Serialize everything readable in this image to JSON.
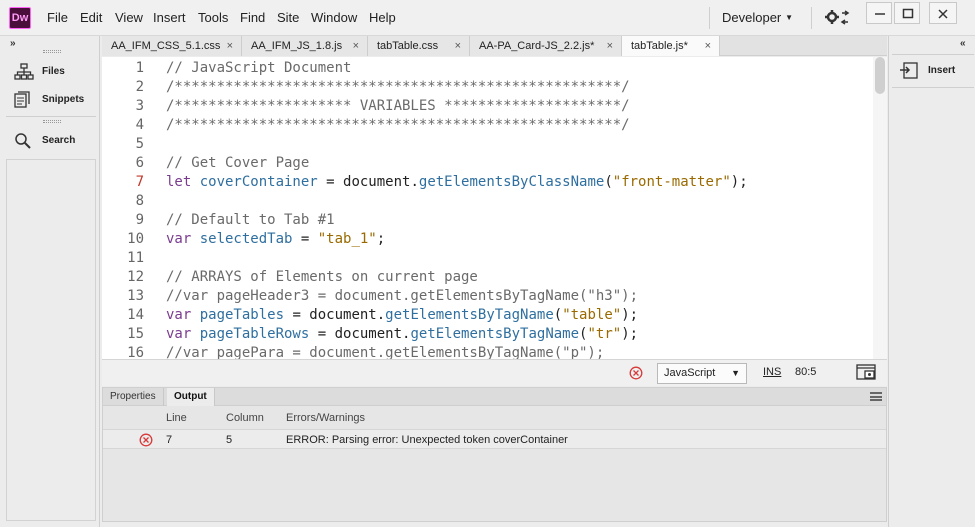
{
  "app": {
    "logo_text": "Dw"
  },
  "menu": [
    "File",
    "Edit",
    "View",
    "Insert",
    "Tools",
    "Find",
    "Site",
    "Window",
    "Help"
  ],
  "workspace": {
    "label": "Developer"
  },
  "left_panel": {
    "collapse_label": "»",
    "items": [
      {
        "label": "Files",
        "icon": "files-icon"
      },
      {
        "label": "Snippets",
        "icon": "snippets-icon"
      },
      {
        "label": "Search",
        "icon": "search-icon"
      }
    ]
  },
  "right_panel": {
    "collapse_label": "«",
    "insert_label": "Insert"
  },
  "tabs": [
    {
      "label": "AA_IFM_CSS_5.1.css",
      "active": false
    },
    {
      "label": "AA_IFM_JS_1.8.js",
      "active": false
    },
    {
      "label": "tabTable.css",
      "active": false
    },
    {
      "label": "AA-PA_Card-JS_2.2.js*",
      "active": false
    },
    {
      "label": "tabTable.js*",
      "active": true
    }
  ],
  "tab_close_label": "×",
  "code_lines": [
    {
      "n": "1",
      "tokens": [
        {
          "t": "// JavaScript Document",
          "c": "comment"
        }
      ]
    },
    {
      "n": "2",
      "tokens": [
        {
          "t": "/*****************************************************/",
          "c": "comment"
        }
      ]
    },
    {
      "n": "3",
      "tokens": [
        {
          "t": "/********************* VARIABLES *********************/",
          "c": "comment"
        }
      ]
    },
    {
      "n": "4",
      "tokens": [
        {
          "t": "/*****************************************************/",
          "c": "comment"
        }
      ]
    },
    {
      "n": "5",
      "tokens": []
    },
    {
      "n": "6",
      "tokens": [
        {
          "t": "// Get Cover Page",
          "c": "comment"
        }
      ]
    },
    {
      "n": "7",
      "error": true,
      "tokens": [
        {
          "t": "let ",
          "c": "keyword"
        },
        {
          "t": "coverContainer",
          "c": "variable"
        },
        {
          "t": " = document.",
          "c": "plain"
        },
        {
          "t": "getElementsByClassName",
          "c": "method"
        },
        {
          "t": "(",
          "c": "plain"
        },
        {
          "t": "\"front-matter\"",
          "c": "string"
        },
        {
          "t": ");",
          "c": "plain"
        }
      ]
    },
    {
      "n": "8",
      "tokens": []
    },
    {
      "n": "9",
      "tokens": [
        {
          "t": "// Default to Tab #1",
          "c": "comment"
        }
      ]
    },
    {
      "n": "10",
      "tokens": [
        {
          "t": "var ",
          "c": "keyword"
        },
        {
          "t": "selectedTab",
          "c": "variable"
        },
        {
          "t": " = ",
          "c": "plain"
        },
        {
          "t": "\"tab_1\"",
          "c": "string"
        },
        {
          "t": ";",
          "c": "plain"
        }
      ]
    },
    {
      "n": "11",
      "tokens": []
    },
    {
      "n": "12",
      "tokens": [
        {
          "t": "// ARRAYS of Elements on current page",
          "c": "comment"
        }
      ]
    },
    {
      "n": "13",
      "tokens": [
        {
          "t": "//var pageHeader3 = document.getElementsByTagName(\"h3\");",
          "c": "comment"
        }
      ]
    },
    {
      "n": "14",
      "tokens": [
        {
          "t": "var ",
          "c": "keyword"
        },
        {
          "t": "pageTables",
          "c": "variable"
        },
        {
          "t": " = document.",
          "c": "plain"
        },
        {
          "t": "getElementsByTagName",
          "c": "method"
        },
        {
          "t": "(",
          "c": "plain"
        },
        {
          "t": "\"table\"",
          "c": "string"
        },
        {
          "t": ");",
          "c": "plain"
        }
      ]
    },
    {
      "n": "15",
      "tokens": [
        {
          "t": "var ",
          "c": "keyword"
        },
        {
          "t": "pageTableRows",
          "c": "variable"
        },
        {
          "t": " = document.",
          "c": "plain"
        },
        {
          "t": "getElementsByTagName",
          "c": "method"
        },
        {
          "t": "(",
          "c": "plain"
        },
        {
          "t": "\"tr\"",
          "c": "string"
        },
        {
          "t": ");",
          "c": "plain"
        }
      ]
    },
    {
      "n": "16",
      "tokens": [
        {
          "t": "//var pagePara = document.getElementsByTagName(\"p\");",
          "c": "comment"
        }
      ]
    }
  ],
  "status_bar": {
    "language": "JavaScript",
    "mode": "INS",
    "position": "80:5"
  },
  "bottom_panel": {
    "tabs": [
      {
        "label": "Properties",
        "active": false
      },
      {
        "label": "Output",
        "active": true
      }
    ],
    "columns": {
      "line": "Line",
      "column": "Column",
      "message": "Errors/Warnings"
    },
    "rows": [
      {
        "line": "7",
        "column": "5",
        "message": "ERROR: Parsing error: Unexpected token coverContainer"
      }
    ]
  },
  "colors": {
    "logo_bg": "#4a0f3b",
    "logo_border": "#ff61f6",
    "error_red": "#d63a3a"
  }
}
